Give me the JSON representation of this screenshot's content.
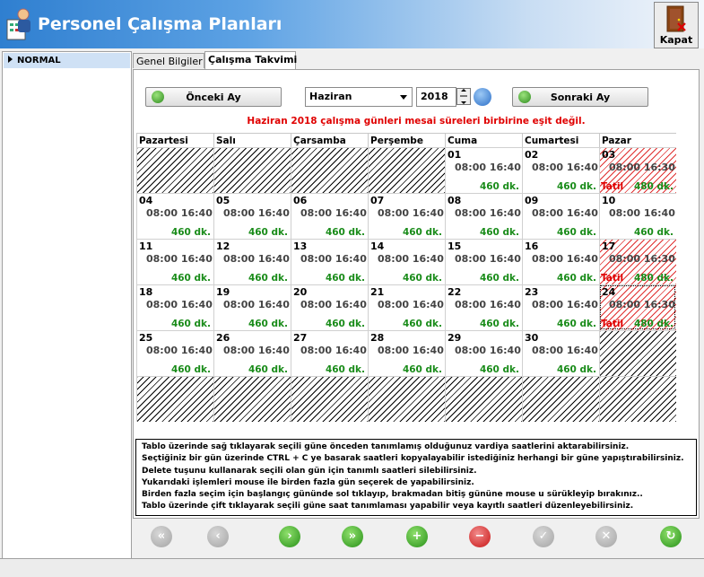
{
  "window": {
    "title": "Personel Çalışma Planları",
    "close_label": "Kapat"
  },
  "sidebar": {
    "items": [
      {
        "label": "NORMAL"
      }
    ]
  },
  "tabs": [
    {
      "label": "Genel Bilgiler"
    },
    {
      "label": "Çalışma Takvimi"
    }
  ],
  "nav": {
    "prev_label": "Önceki Ay",
    "next_label": "Sonraki Ay",
    "month": "Haziran",
    "year": "2018"
  },
  "warning": "Haziran 2018 çalışma günleri mesai süreleri birbirine eşit değil.",
  "weekdays": [
    "Pazartesi",
    "Salı",
    "Çarsamba",
    "Perşembe",
    "Cuma",
    "Cumartesi",
    "Pazar"
  ],
  "calendar": {
    "rows": [
      [
        null,
        null,
        null,
        null,
        {
          "day": "01",
          "hours": "08:00 16:40",
          "mins": "460 dk."
        },
        {
          "day": "02",
          "hours": "08:00 16:40",
          "mins": "460 dk."
        },
        {
          "day": "03",
          "hours": "08:00 16:30",
          "mins": "480 dk.",
          "holiday": "Tatil"
        }
      ],
      [
        {
          "day": "04",
          "hours": "08:00 16:40",
          "mins": "460 dk."
        },
        {
          "day": "05",
          "hours": "08:00 16:40",
          "mins": "460 dk."
        },
        {
          "day": "06",
          "hours": "08:00 16:40",
          "mins": "460 dk."
        },
        {
          "day": "07",
          "hours": "08:00 16:40",
          "mins": "460 dk."
        },
        {
          "day": "08",
          "hours": "08:00 16:40",
          "mins": "460 dk."
        },
        {
          "day": "09",
          "hours": "08:00 16:40",
          "mins": "460 dk."
        },
        {
          "day": "10",
          "hours": "08:00 16:40",
          "mins": "460 dk."
        }
      ],
      [
        {
          "day": "11",
          "hours": "08:00 16:40",
          "mins": "460 dk."
        },
        {
          "day": "12",
          "hours": "08:00 16:40",
          "mins": "460 dk."
        },
        {
          "day": "13",
          "hours": "08:00 16:40",
          "mins": "460 dk."
        },
        {
          "day": "14",
          "hours": "08:00 16:40",
          "mins": "460 dk."
        },
        {
          "day": "15",
          "hours": "08:00 16:40",
          "mins": "460 dk."
        },
        {
          "day": "16",
          "hours": "08:00 16:40",
          "mins": "460 dk."
        },
        {
          "day": "17",
          "hours": "08:00 16:30",
          "mins": "480 dk.",
          "holiday": "Tatil"
        }
      ],
      [
        {
          "day": "18",
          "hours": "08:00 16:40",
          "mins": "460 dk."
        },
        {
          "day": "19",
          "hours": "08:00 16:40",
          "mins": "460 dk."
        },
        {
          "day": "20",
          "hours": "08:00 16:40",
          "mins": "460 dk."
        },
        {
          "day": "21",
          "hours": "08:00 16:40",
          "mins": "460 dk."
        },
        {
          "day": "22",
          "hours": "08:00 16:40",
          "mins": "460 dk."
        },
        {
          "day": "23",
          "hours": "08:00 16:40",
          "mins": "460 dk."
        },
        {
          "day": "24",
          "hours": "08:00 16:30",
          "mins": "480 dk.",
          "holiday": "Tatil",
          "selected": true
        }
      ],
      [
        {
          "day": "25",
          "hours": "08:00 16:40",
          "mins": "460 dk."
        },
        {
          "day": "26",
          "hours": "08:00 16:40",
          "mins": "460 dk."
        },
        {
          "day": "27",
          "hours": "08:00 16:40",
          "mins": "460 dk."
        },
        {
          "day": "28",
          "hours": "08:00 16:40",
          "mins": "460 dk."
        },
        {
          "day": "29",
          "hours": "08:00 16:40",
          "mins": "460 dk."
        },
        {
          "day": "30",
          "hours": "08:00 16:40",
          "mins": "460 dk."
        },
        null
      ],
      [
        null,
        null,
        null,
        null,
        null,
        null,
        null
      ]
    ]
  },
  "info_lines": [
    "Tablo üzerinde sağ tıklayarak seçili güne önceden tanımlamış olduğunuz vardiya saatlerini aktarabilirsiniz.",
    "Seçtiğiniz bir gün üzerinde CTRL + C ye basarak saatleri kopyalayabilir istediğiniz herhangi bir güne yapıştırabilirsiniz.",
    "Delete tuşunu kullanarak seçili olan gün için tanımlı saatleri silebilirsiniz.",
    "Yukarıdaki işlemleri mouse ile birden fazla gün seçerek de yapabilirsiniz.",
    "Birden fazla seçim için başlangıç gününde sol tıklayıp, brakmadan bitiş gününe mouse u sürükleyip bırakınız..",
    "Tablo üzerinde çift tıklayarak seçili güne saat tanımlaması yapabilir veya kayıtlı saatleri düzenleyebilirsiniz."
  ],
  "toolbar": [
    {
      "icon": "first-icon",
      "style": "g",
      "glyph": "«"
    },
    {
      "icon": "prev-icon",
      "style": "g",
      "glyph": "‹"
    },
    {
      "icon": "next-icon",
      "style": "gr",
      "glyph": "›"
    },
    {
      "icon": "last-icon",
      "style": "gr",
      "glyph": "»"
    },
    {
      "icon": "add-icon",
      "style": "gr",
      "glyph": "+"
    },
    {
      "icon": "delete-icon",
      "style": "rd",
      "glyph": "−"
    },
    {
      "icon": "check-icon",
      "style": "g",
      "glyph": "✓"
    },
    {
      "icon": "cancel-icon",
      "style": "g",
      "glyph": "✕"
    },
    {
      "icon": "refresh-icon",
      "style": "gr",
      "glyph": "↻"
    }
  ]
}
